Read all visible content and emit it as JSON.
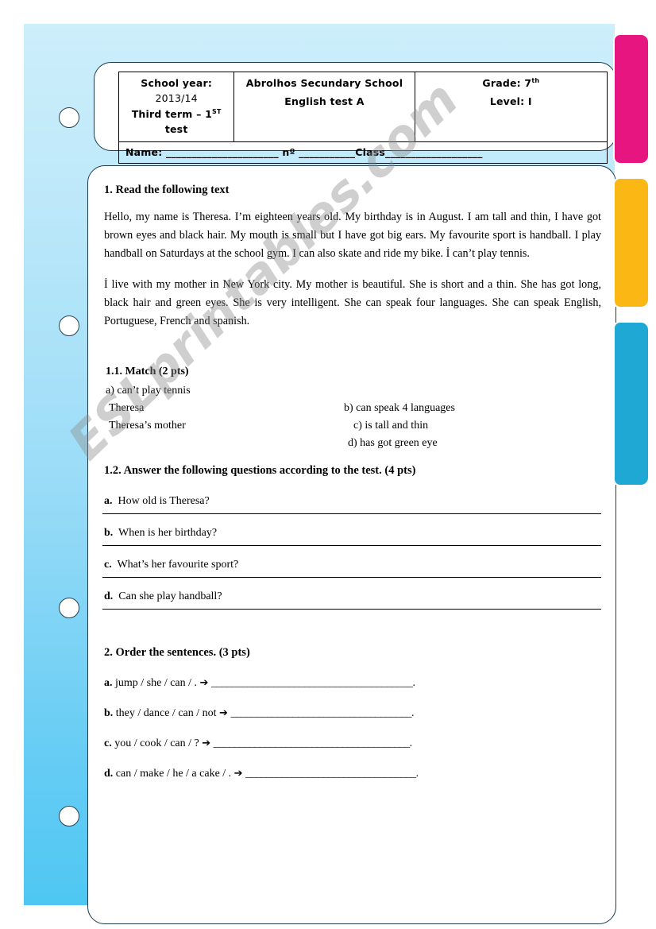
{
  "header": {
    "school_year_label": "School year:",
    "school_year_value": "2013/14",
    "term_label": "Third term – 1",
    "term_sup": "ST",
    "term_suffix": " test",
    "school_name": "Abrolhos  Secundary  School",
    "test_name": "English test A",
    "grade_label": "Grade: 7",
    "grade_sup": "th",
    "level_label": "Level: I",
    "name_field": "Name: ______________________ nº ___________Class___________________"
  },
  "exercise1": {
    "title": "1.  Read the following text",
    "paragraph1": "Hello, my name is Theresa. I’m eighteen years old. My birthday is in August. I am tall and thin, I have got brown eyes and black hair. My mouth is small but I have got big ears. My favourite sport is handball. I play handball on Saturdays at the school gym. I can also skate and ride my bike. İ can’t play tennis.",
    "paragraph2": "İ live with my mother in New York city. My mother is beautiful. She is short and a thin. She has got long, black hair and green eyes. She is very intelligent. She can speak four languages. She can speak English, Portuguese, French and spanish."
  },
  "match": {
    "title": "1.1. Match   (2 pts)",
    "option_a": "a)  can’t play tennis",
    "subject_1": "Theresa",
    "subject_2": "Theresa’s mother",
    "option_b": "b) can speak 4 languages",
    "option_c": "c) is tall and thin",
    "option_d": "d) has got green eye"
  },
  "answer_questions": {
    "title": "1.2. Answer the following questions according to the test. (4 pts)",
    "items": [
      {
        "letter": "a.",
        "text": "How old is Theresa?"
      },
      {
        "letter": "b.",
        "text": "When is her birthday?"
      },
      {
        "letter": "c.",
        "text": "What’s her favourite sport?"
      },
      {
        "letter": "d.",
        "text": "Can she play handball?"
      }
    ]
  },
  "exercise2": {
    "title": "2. Order the sentences. (3 pts)",
    "items": [
      {
        "letter": "a.",
        "words": "jump / she / can / .",
        "arrow": "➔",
        "blank": "_______________________________________",
        "end": "."
      },
      {
        "letter": "b.",
        "words": "they / dance / can / not",
        "arrow": "➔",
        "blank": "___________________________________",
        "end": "."
      },
      {
        "letter": "c.",
        "words": "you /  cook / can / ?",
        "arrow": "➔",
        "blank": "______________________________________",
        "end": "."
      },
      {
        "letter": "d.",
        "words": "can / make / he / a cake / .",
        "arrow": "➔",
        "blank": "_________________________________",
        "end": "."
      }
    ]
  },
  "watermark": {
    "text": "ESLprintables.com"
  },
  "decor": {
    "tab_pink": "#e6157f",
    "tab_yellow": "#fbb713",
    "tab_blue": "#1fa8d4",
    "sheet_blue": "#68cdf4",
    "card_border": "#1d3c4e"
  }
}
